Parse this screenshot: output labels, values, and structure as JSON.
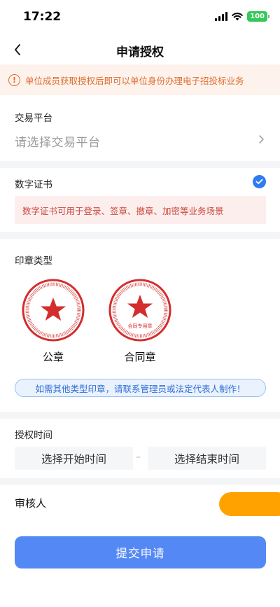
{
  "status_bar": {
    "time": "17:22",
    "battery": "100"
  },
  "nav": {
    "title": "申请授权"
  },
  "notice": {
    "icon_text": "!",
    "text": "单位成员获取授权后即可以单位身份办理电子招投标业务"
  },
  "platform": {
    "label": "交易平台",
    "placeholder": "请选择交易平台"
  },
  "certificate": {
    "label": "数字证书",
    "checked": true,
    "description": "数字证书可用于登录、签章、撤章、加密等业务场景"
  },
  "seal": {
    "label": "印章类型",
    "options": [
      {
        "name": "公章",
        "stamp_text": ""
      },
      {
        "name": "合同章",
        "stamp_text": "合同专用章"
      }
    ],
    "hint": "如需其他类型印章，请联系管理员或法定代表人制作！"
  },
  "auth_time": {
    "label": "授权时间",
    "start_placeholder": "选择开始时间",
    "separator": "–",
    "end_placeholder": "选择结束时间"
  },
  "reviewer": {
    "label": "审核人"
  },
  "submit": {
    "label": "提交申请"
  },
  "colors": {
    "accent": "#5489f5",
    "check": "#2f7bf0",
    "warning": "#e06b2e",
    "danger": "#c94a3b",
    "seal_red": "#d42d2d",
    "reviewer_button": "#ffa200"
  }
}
